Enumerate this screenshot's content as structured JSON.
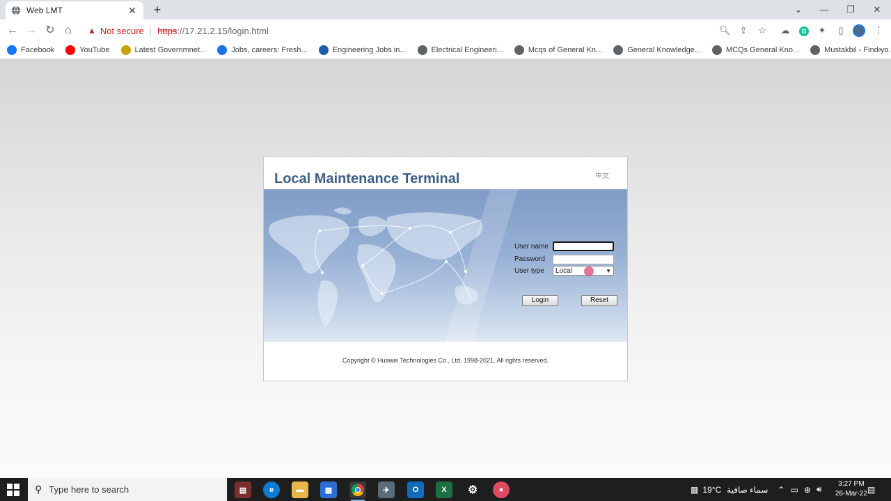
{
  "browser": {
    "tab_title": "Web LMT",
    "url_https": "https",
    "url_rest": "://17.21.2.15/login.html",
    "security_label": "Not secure",
    "bookmarks": [
      {
        "label": "Facebook",
        "icon": "facebook-icon",
        "color": "#1877f2"
      },
      {
        "label": "YouTube",
        "icon": "youtube-icon",
        "color": "#ff0000"
      },
      {
        "label": "Latest Governmnet...",
        "icon": "bookmark-icon",
        "color": "#c8a200"
      },
      {
        "label": "Jobs, careers: Fresh...",
        "icon": "bookmark-icon",
        "color": "#1a73e8"
      },
      {
        "label": "Engineering Jobs in...",
        "icon": "bookmark-icon",
        "color": "#1f5fa8"
      },
      {
        "label": "Electrical Engineeri...",
        "icon": "globe-icon",
        "color": "#5f6368"
      },
      {
        "label": "Mcqs of General Kn...",
        "icon": "globe-icon",
        "color": "#5f6368"
      },
      {
        "label": "General Knowledge...",
        "icon": "globe-icon",
        "color": "#5f6368"
      },
      {
        "label": "MCQs General Kno...",
        "icon": "globe-icon",
        "color": "#5f6368"
      },
      {
        "label": "Mustakbil - Find yo...",
        "icon": "globe-icon",
        "color": "#5f6368"
      }
    ]
  },
  "lmt": {
    "title": "Local Maintenance Terminal",
    "language_link": "中文",
    "username_label": "User name",
    "username_value": "",
    "password_label": "Password",
    "password_value": "",
    "usertype_label": "User type",
    "usertype_value": "Local",
    "login_label": "Login",
    "reset_label": "Reset",
    "copyright": "Copyright © Huawei Technologies Co., Ltd. 1998-2021. All rights reserved."
  },
  "taskbar": {
    "search_placeholder": "Type here to search",
    "temperature": "19°C",
    "weather_text": "سماء صافية",
    "time": "3:27 PM",
    "date": "26-Mar-22"
  }
}
